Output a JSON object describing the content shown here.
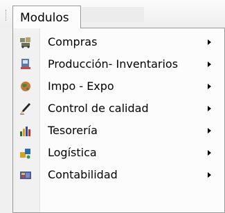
{
  "menu": {
    "title": "Modulos",
    "items": [
      {
        "label": "Compras",
        "icon": "compras-icon"
      },
      {
        "label": "Producción- Inventarios",
        "icon": "produccion-inventarios-icon"
      },
      {
        "label": "Impo - Expo",
        "icon": "impo-expo-globe-icon"
      },
      {
        "label": "Control de calidad",
        "icon": "control-calidad-pen-icon"
      },
      {
        "label": "Tesorería",
        "icon": "tesoreria-chart-icon"
      },
      {
        "label": "Logística",
        "icon": "logistica-icon"
      },
      {
        "label": "Contabilidad",
        "icon": "contabilidad-icon"
      }
    ]
  }
}
